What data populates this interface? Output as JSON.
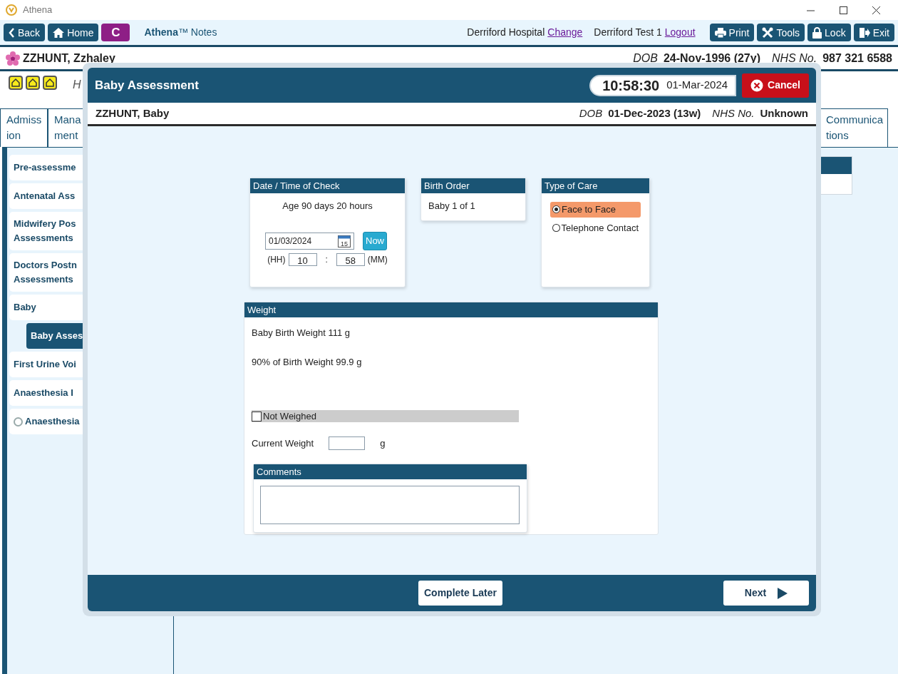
{
  "window": {
    "title": "Athena"
  },
  "toolbar": {
    "left_buttons": [
      {
        "label": "Back"
      },
      {
        "label": "Home"
      },
      {
        "label": "C"
      }
    ],
    "app_name": "**Athena**™ Notes",
    "site": "Derriford Hospital",
    "site_link": "Change",
    "user": "Derriford Test 1",
    "user_link": "Logout",
    "right_buttons": [
      {
        "label": "Print"
      },
      {
        "label": "Tools"
      },
      {
        "label": "Lock"
      },
      {
        "label": "Exit"
      }
    ]
  },
  "patient": {
    "name": "ZZHUNT, Zzhaley",
    "dob_label": "DOB",
    "dob": "24-Nov-1996 (27y)",
    "nhs_label": "NHS No.",
    "nhs": "987 321 6588"
  },
  "header_note": "H",
  "tabs": [
    {
      "label": "Admiss\nion"
    },
    {
      "label": "Mana\nment"
    },
    {
      "label": "Communica\ntions"
    }
  ],
  "sidebar": {
    "items": [
      {
        "label": "Pre-assessme",
        "kind": "plain",
        "selected": false
      },
      {
        "label": "Antenatal Ass",
        "kind": "plain",
        "selected": false
      },
      {
        "label": "Midwifery Pos\nAssessments",
        "kind": "plain",
        "selected": false
      },
      {
        "label": "Doctors Postn\nAssessments",
        "kind": "plain",
        "selected": false
      },
      {
        "label": "Baby",
        "kind": "plain",
        "selected": false,
        "children": [
          {
            "label": "Baby Asses",
            "selected": true
          }
        ]
      },
      {
        "label": "First Urine Voi",
        "kind": "plain",
        "selected": false
      },
      {
        "label": "Anaesthesia I",
        "kind": "plain",
        "selected": false
      },
      {
        "label": "Anaesthesia",
        "kind": "radio",
        "selected": false
      }
    ]
  },
  "modal": {
    "title": "Baby Assessment",
    "time": "10:58:30",
    "date": "01-Mar-2024",
    "cancel": "Cancel",
    "patient": {
      "name": "ZZHUNT, Baby",
      "dob_label": "DOB",
      "dob": "01-Dec-2023 (13w)",
      "nhs_label": "NHS No.",
      "nhs": "Unknown"
    },
    "date_card": {
      "title": "Date / Time of Check",
      "age": "Age 90 days 20 hours",
      "date_value": "01/03/2024",
      "calendar_day": "15",
      "now_button": "Now",
      "hh_label": "(HH)",
      "hh": "10",
      "separator": ":",
      "mm": "58",
      "mm_label": "(MM)"
    },
    "birth_order": {
      "title": "Birth Order",
      "text": "Baby 1 of 1"
    },
    "type_of_care": {
      "title": "Type of Care",
      "options": [
        {
          "label": "Face to Face",
          "selected": true
        },
        {
          "label": "Telephone Contact",
          "selected": false
        }
      ]
    },
    "weight": {
      "title": "Weight",
      "birth_weight": "Baby Birth Weight 111 g",
      "ninety_percent": "90% of Birth Weight 99.9 g",
      "not_weighed": {
        "label": "Not Weighed",
        "checked": false
      },
      "current_weight_label": "Current Weight",
      "unit": "g",
      "comments_title": "Comments"
    },
    "footer": {
      "complete_later": "Complete Later",
      "next": "Next"
    }
  }
}
